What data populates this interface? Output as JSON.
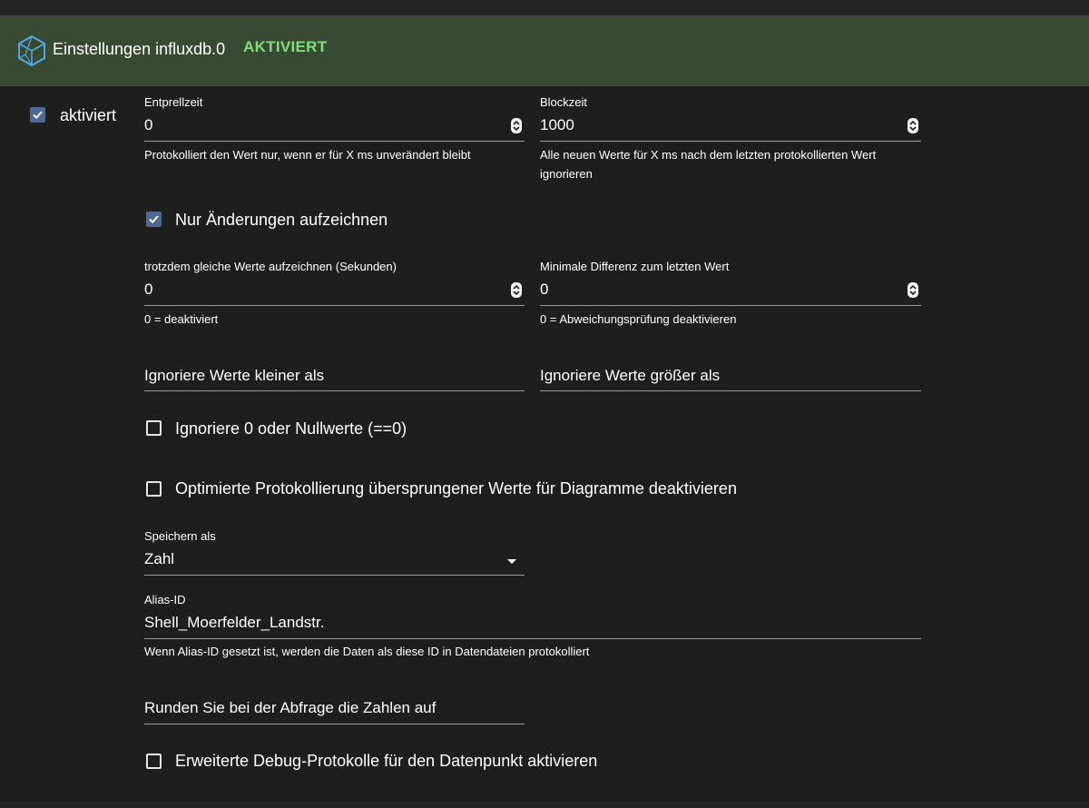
{
  "header": {
    "title": "Einstellungen influxdb.0",
    "status": "AKTIVIERT",
    "logo_icon": "influxdb-cube-icon",
    "background": "#394a32",
    "status_color": "#7ee07a"
  },
  "enabled": {
    "label": "aktiviert",
    "checked": true
  },
  "debounce": {
    "label": "Entprellzeit",
    "value": "0",
    "helper": "Protokolliert den Wert nur, wenn er für X ms unverändert bleibt"
  },
  "blocktime": {
    "label": "Blockzeit",
    "value": "1000",
    "helper": "Alle neuen Werte für X ms nach dem letzten protokollierten Wert ignorieren"
  },
  "changes_only": {
    "label": "Nur Änderungen aufzeichnen",
    "checked": true
  },
  "same_values": {
    "label": "trotzdem gleiche Werte aufzeichnen (Sekunden)",
    "value": "0",
    "helper": "0 = deaktiviert"
  },
  "min_diff": {
    "label": "Minimale Differenz zum letzten Wert",
    "value": "0",
    "helper": "0 = Abweichungsprüfung deaktivieren"
  },
  "ignore_below": {
    "placeholder": "Ignoriere Werte kleiner als"
  },
  "ignore_above": {
    "placeholder": "Ignoriere Werte größer als"
  },
  "ignore_zero": {
    "label": "Ignoriere 0 oder Nullwerte (==0)",
    "checked": false
  },
  "disable_optimized": {
    "label": "Optimierte Protokollierung übersprungener Werte für Diagramme deaktivieren",
    "checked": false
  },
  "store_as": {
    "label": "Speichern als",
    "value": "Zahl"
  },
  "alias": {
    "label": "Alias-ID",
    "value": "Shell_Moerfelder_Landstr.",
    "helper": "Wenn Alias-ID gesetzt ist, werden die Daten als diese ID in Datendateien protokolliert"
  },
  "round": {
    "placeholder": "Runden Sie bei der Abfrage die Zahlen auf"
  },
  "debug": {
    "label": "Erweiterte Debug-Protokolle für den Datenpunkt aktivieren",
    "checked": false
  }
}
